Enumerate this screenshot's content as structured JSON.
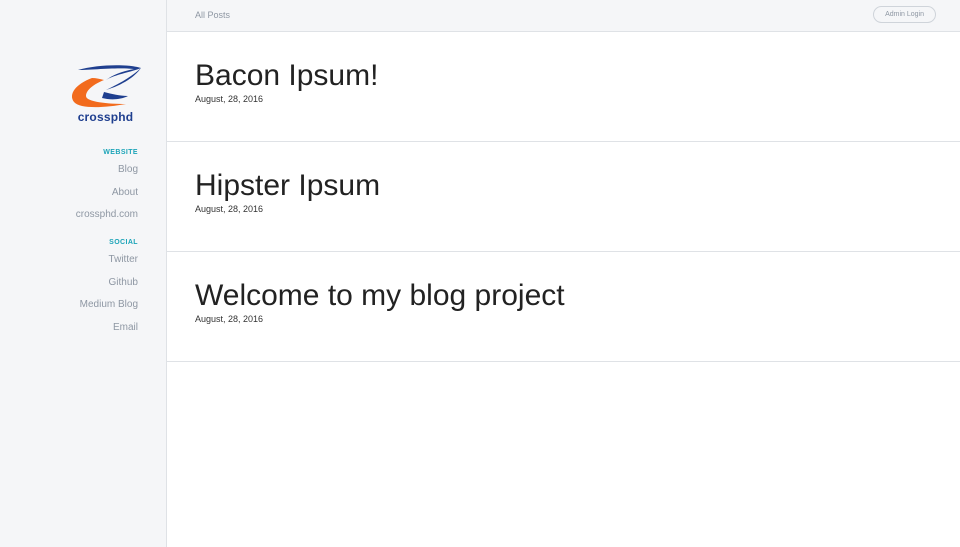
{
  "header": {
    "breadcrumb": "All Posts",
    "login_label": "Admin Login"
  },
  "sidebar": {
    "logo_text": "crossphd",
    "logo_icon": "crossphd-swoosh-logo",
    "sections": [
      {
        "title": "WEBSITE",
        "items": [
          "Blog",
          "About",
          "crossphd.com"
        ]
      },
      {
        "title": "SOCIAL",
        "items": [
          "Twitter",
          "Github",
          "Medium Blog",
          "Email"
        ]
      }
    ]
  },
  "posts": [
    {
      "title": "Bacon Ipsum!",
      "date": "August, 28, 2016"
    },
    {
      "title": "Hipster Ipsum",
      "date": "August, 28, 2016"
    },
    {
      "title": "Welcome to my blog project",
      "date": "August, 28, 2016"
    }
  ],
  "colors": {
    "sidebar_bg": "#f5f6f8",
    "section_accent": "#1ca4b8",
    "nav_text": "#8e97a3",
    "logo_blue": "#1f3f8f",
    "logo_orange": "#f26b1d"
  }
}
